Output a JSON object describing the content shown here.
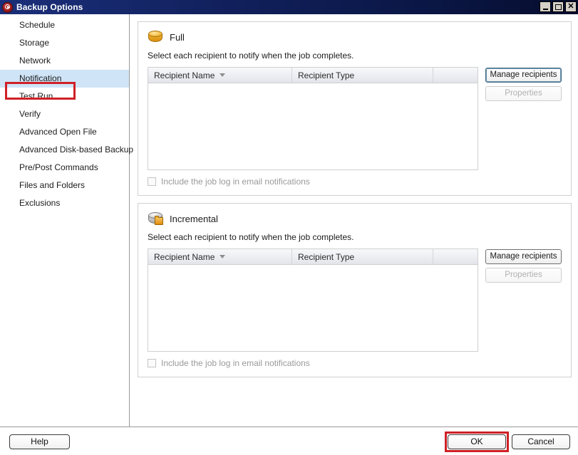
{
  "window": {
    "title": "Backup Options",
    "icon": "app-disc-icon",
    "controls": {
      "minimize": "_",
      "maximize": "□",
      "close": "✕"
    }
  },
  "sidebar": {
    "items": [
      {
        "label": "Schedule",
        "selected": false
      },
      {
        "label": "Storage",
        "selected": false
      },
      {
        "label": "Network",
        "selected": false
      },
      {
        "label": "Notification",
        "selected": true
      },
      {
        "label": "Test Run",
        "selected": false
      },
      {
        "label": "Verify",
        "selected": false
      },
      {
        "label": "Advanced Open File",
        "selected": false
      },
      {
        "label": "Advanced Disk-based Backup",
        "selected": false
      },
      {
        "label": "Pre/Post Commands",
        "selected": false
      },
      {
        "label": "Files and Folders",
        "selected": false
      },
      {
        "label": "Exclusions",
        "selected": false
      }
    ],
    "highlight_color": "#cfe4f7"
  },
  "annotations": {
    "color": "#cf2026",
    "boxes": [
      {
        "target": "sidebar-item-notification"
      },
      {
        "target": "ok-button"
      }
    ]
  },
  "sections": [
    {
      "id": "full",
      "icon": "disk-orange-icon",
      "title": "Full",
      "description": "Select each recipient to notify when the job completes.",
      "table": {
        "columns": [
          "Recipient Name",
          "Recipient Type",
          ""
        ],
        "sorted_column": "Recipient Name",
        "sort_direction": "descending",
        "rows": []
      },
      "buttons": [
        {
          "label": "Manage recipients",
          "enabled": true,
          "focused": true
        },
        {
          "label": "Properties",
          "enabled": false,
          "focused": false
        }
      ],
      "checkbox": {
        "label": "Include the job log in email notifications",
        "checked": false,
        "enabled": false
      }
    },
    {
      "id": "incremental",
      "icon": "disk-gray-folder-icon",
      "title": "Incremental",
      "description": "Select each recipient to notify when the job completes.",
      "table": {
        "columns": [
          "Recipient Name",
          "Recipient Type",
          ""
        ],
        "sorted_column": "Recipient Name",
        "sort_direction": "descending",
        "rows": []
      },
      "buttons": [
        {
          "label": "Manage recipients",
          "enabled": true,
          "focused": false
        },
        {
          "label": "Properties",
          "enabled": false,
          "focused": false
        }
      ],
      "checkbox": {
        "label": "Include the job log in email notifications",
        "checked": false,
        "enabled": false
      }
    }
  ],
  "footer": {
    "help_label": "Help",
    "ok_label": "OK",
    "cancel_label": "Cancel"
  }
}
